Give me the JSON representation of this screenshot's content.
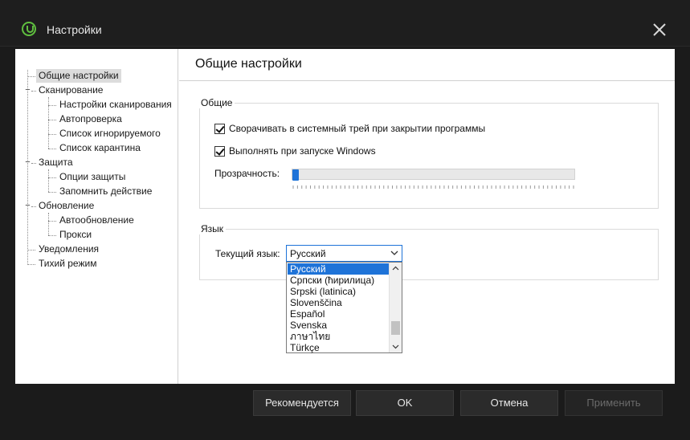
{
  "window": {
    "title": "Настройки"
  },
  "tree": [
    {
      "label": "Общие настройки",
      "level": 0,
      "selected": true
    },
    {
      "label": "Сканирование",
      "level": 0
    },
    {
      "label": "Настройки сканирования",
      "level": 1
    },
    {
      "label": "Автопроверка",
      "level": 1
    },
    {
      "label": "Список игнорируемого",
      "level": 1
    },
    {
      "label": "Список карантина",
      "level": 1
    },
    {
      "label": "Защита",
      "level": 0
    },
    {
      "label": "Опции защиты",
      "level": 1
    },
    {
      "label": "Запомнить действие",
      "level": 1
    },
    {
      "label": "Обновление",
      "level": 0
    },
    {
      "label": "Автообновление",
      "level": 1
    },
    {
      "label": "Прокси",
      "level": 1
    },
    {
      "label": "Уведомления",
      "level": 0
    },
    {
      "label": "Тихий режим",
      "level": 0
    }
  ],
  "main": {
    "page_title": "Общие настройки",
    "general_group": {
      "label": "Общие",
      "minimize_to_tray": {
        "label": "Сворачивать в системный трей при закрытии программы",
        "checked": true
      },
      "run_on_startup": {
        "label": "Выполнять при запуске Windows",
        "checked": true
      },
      "transparency_label": "Прозрачность:",
      "transparency_value": 0
    },
    "language_group": {
      "label": "Язык",
      "current_label": "Текущий язык:",
      "current_value": "Русский",
      "options": [
        "Русский",
        "Српски (ћирилица)",
        "Srpski (latinica)",
        "Slovenščina",
        "Español",
        "Svenska",
        "ภาษาไทย",
        "Türkçe"
      ]
    }
  },
  "footer": {
    "recommended": "Рекомендуется",
    "ok": "OK",
    "cancel": "Отмена",
    "apply": "Применить"
  },
  "colors": {
    "accent": "#1e73d8",
    "brand": "#5fbf3f"
  }
}
